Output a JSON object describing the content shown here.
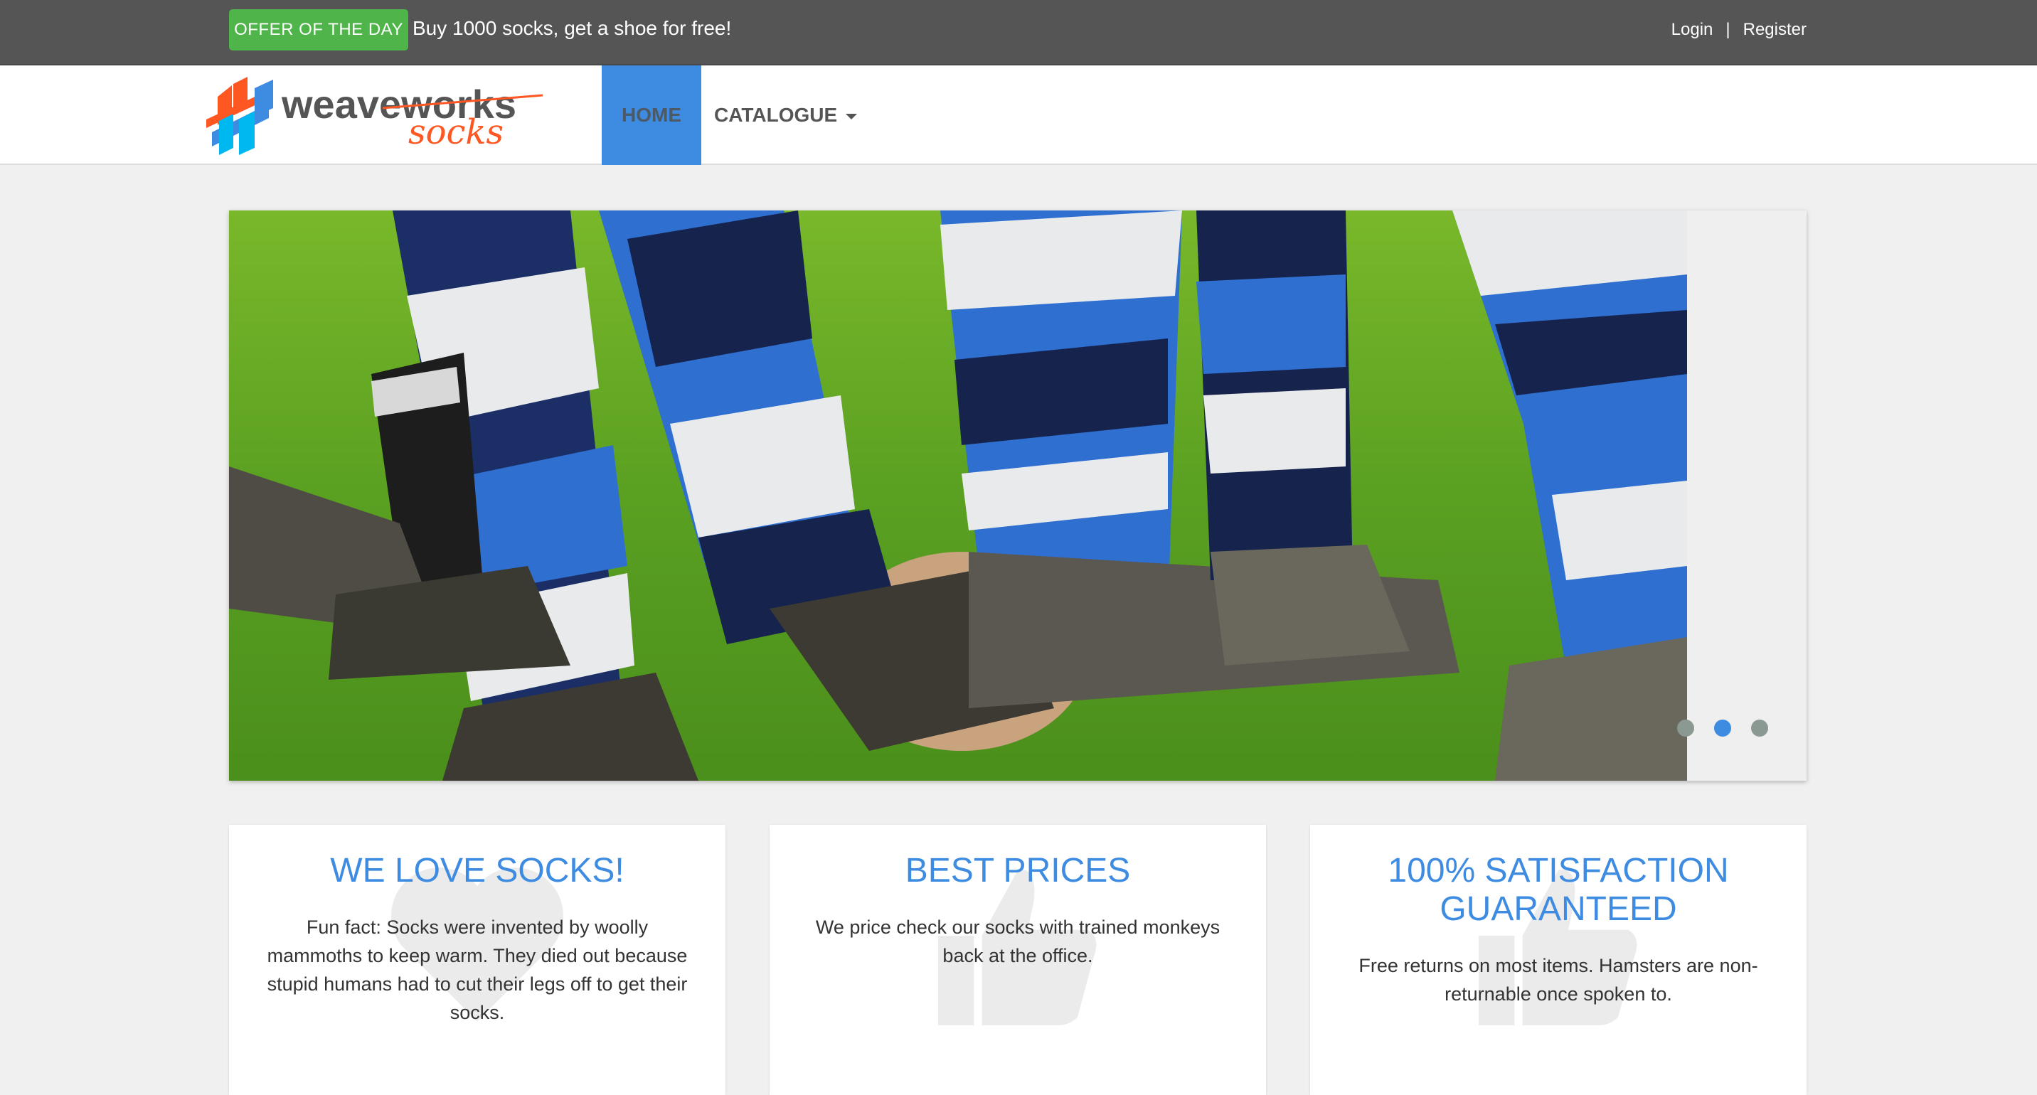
{
  "topbar": {
    "offer_badge": "OFFER OF THE DAY",
    "offer_text": "Buy 1000 socks, get a shoe for free!",
    "login": "Login",
    "separator": "|",
    "register": "Register"
  },
  "brand": {
    "logo_word1": "weaveworks",
    "logo_word2": "socks"
  },
  "nav": {
    "home": "HOME",
    "catalogue": "CATALOGUE"
  },
  "carousel": {
    "slide_count": 3,
    "active_index": 1
  },
  "features": [
    {
      "title": "WE LOVE SOCKS!",
      "text": "Fun fact: Socks were invented by woolly mammoths to keep warm. They died out because stupid humans had to cut their legs off to get their socks."
    },
    {
      "title": "BEST PRICES",
      "text": "We price check our socks with trained monkeys back at the office."
    },
    {
      "title": "100% SATISFACTION GUARANTEED",
      "text": "Free returns on most items. Hamsters are non-returnable once spoken to."
    }
  ],
  "colors": {
    "accent": "#3e8ce2",
    "offer_green": "#4fb54a",
    "topbar": "#555555"
  }
}
